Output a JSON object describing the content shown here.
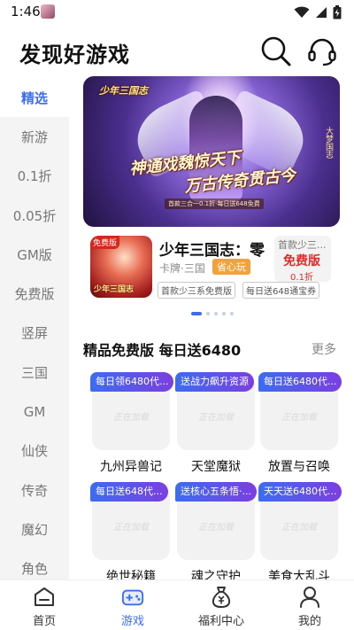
{
  "status_bar": {
    "time": "1:46"
  },
  "header": {
    "title": "发现好游戏"
  },
  "sidebar": {
    "items": [
      {
        "label": "精选"
      },
      {
        "label": "新游"
      },
      {
        "label": "0.1折"
      },
      {
        "label": "0.05折"
      },
      {
        "label": "GM版"
      },
      {
        "label": "免费版"
      },
      {
        "label": "竖屏"
      },
      {
        "label": "三国"
      },
      {
        "label": "GM"
      },
      {
        "label": "仙侠"
      },
      {
        "label": "传奇"
      },
      {
        "label": "魔幻"
      },
      {
        "label": "角色"
      }
    ],
    "active_index": 0
  },
  "banner": {
    "logo": "少年三国志",
    "headline1": "神通戏魏惊天下",
    "headline2": "万古传奇贯古今",
    "sub": "首款三合一0.1折·每日送648免费",
    "side": "大梦国志"
  },
  "featured_game": {
    "name": "少年三国志：零",
    "meta": "卡牌·三国",
    "tag": "省心玩",
    "chips": [
      "首款少三系免费版",
      "每日送648通宝券"
    ],
    "promo": "首款少三...",
    "thumb_badge": "免费版",
    "thumb_logo": "少年三国志",
    "free_badge": {
      "title": "免费版",
      "sub": "0.1折"
    }
  },
  "carousel": {
    "count": 5,
    "active": 0
  },
  "section": {
    "title": "精品免费版 每日送6480",
    "more": "更多"
  },
  "loading_text": "正在加载",
  "games": [
    {
      "tag": "每日领6480代...",
      "name": "九州异兽记"
    },
    {
      "tag": "送战力飙升资源",
      "name": "天堂魔狱"
    },
    {
      "tag": "每日送6480代...",
      "name": "放置与召唤"
    },
    {
      "tag": "每日送648代...",
      "name": "绝世秘籍"
    },
    {
      "tag": "送核心五条悟·...",
      "name": "魂之守护"
    },
    {
      "tag": "天天送6480代...",
      "name": "美食大乱斗"
    }
  ],
  "bottom_nav": {
    "items": [
      {
        "label": "首页",
        "icon": "home-icon"
      },
      {
        "label": "游戏",
        "icon": "gamepad-icon"
      },
      {
        "label": "福利中心",
        "icon": "money-bag-icon"
      },
      {
        "label": "我的",
        "icon": "profile-icon"
      }
    ],
    "active_index": 1
  },
  "colors": {
    "accent": "#3c6cf2",
    "tag_gradient_end": "#7b3fe0",
    "free_red": "#e12b2b",
    "tag_orange": "#f3a23b"
  }
}
